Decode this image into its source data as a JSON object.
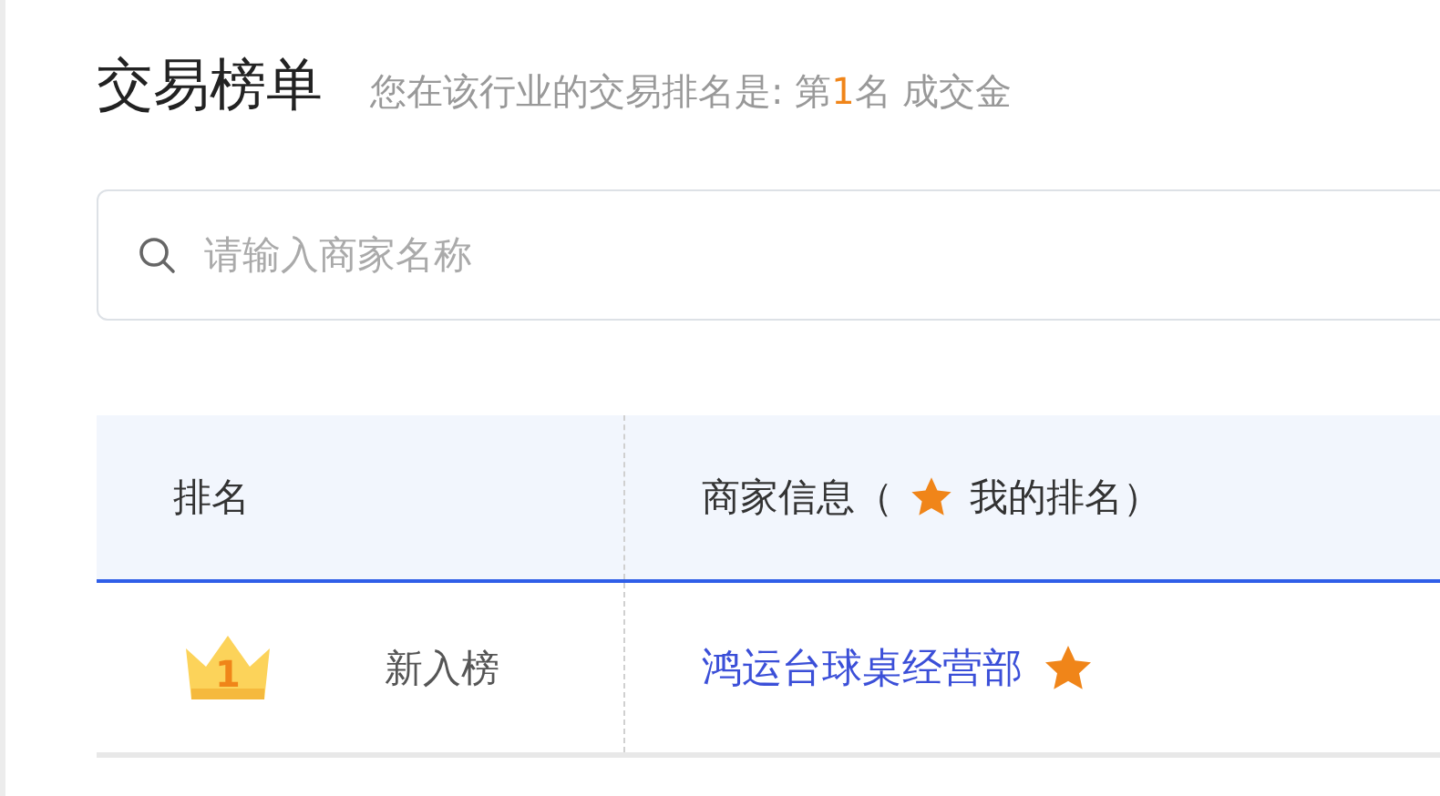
{
  "title": "交易榜单",
  "summary": {
    "prefix": "您在该行业的交易排名是: 第",
    "rank": "1",
    "suffix": "名 成交金"
  },
  "search": {
    "placeholder": "请输入商家名称"
  },
  "table": {
    "columns": [
      {
        "kind": "text",
        "label": "排名"
      },
      {
        "kind": "mine",
        "label_before": "商家信息（",
        "label_after": "我的排名）"
      }
    ],
    "rows": [
      {
        "rank": "1",
        "status": "新入榜",
        "merchant": "鸿运台球桌经营部",
        "mine": true
      }
    ]
  }
}
